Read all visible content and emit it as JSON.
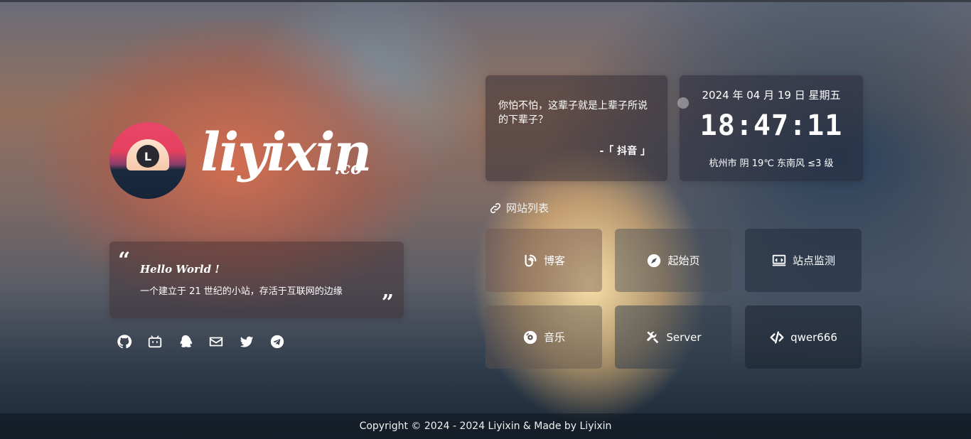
{
  "logo": {
    "avatar_letter": "L",
    "name": "liyixin",
    "suffix": ".co"
  },
  "intro": {
    "title": "Hello World !",
    "text": "一个建立于 21 世纪的小站，存活于互联网的边缘",
    "open_quote": "“",
    "close_quote": "”"
  },
  "socials": [
    {
      "icon": "github-icon"
    },
    {
      "icon": "bilibili-icon"
    },
    {
      "icon": "qq-icon"
    },
    {
      "icon": "mail-icon"
    },
    {
      "icon": "twitter-icon"
    },
    {
      "icon": "telegram-icon"
    }
  ],
  "hitokoto": {
    "text": "你怕不怕，这辈子就是上辈子所说的下辈子？",
    "from": "-「 抖音 」"
  },
  "clock": {
    "date": "2024 年 04 月 19 日 星期五",
    "time": "18:47:11",
    "weather": "杭州市 阴 19℃  东南风  ≤3 级"
  },
  "sites": {
    "title": "网站列表",
    "items": [
      {
        "label": "博客",
        "icon": "blog-icon"
      },
      {
        "label": "起始页",
        "icon": "compass-icon"
      },
      {
        "label": "站点监测",
        "icon": "monitor-icon"
      },
      {
        "label": "音乐",
        "icon": "disc-icon"
      },
      {
        "label": "Server",
        "icon": "tools-icon"
      },
      {
        "label": "qwer666",
        "icon": "code-icon"
      }
    ]
  },
  "footer": {
    "copyright": "Copyright © 2024 - 2024 Liyixin & Made by Liyixin"
  }
}
